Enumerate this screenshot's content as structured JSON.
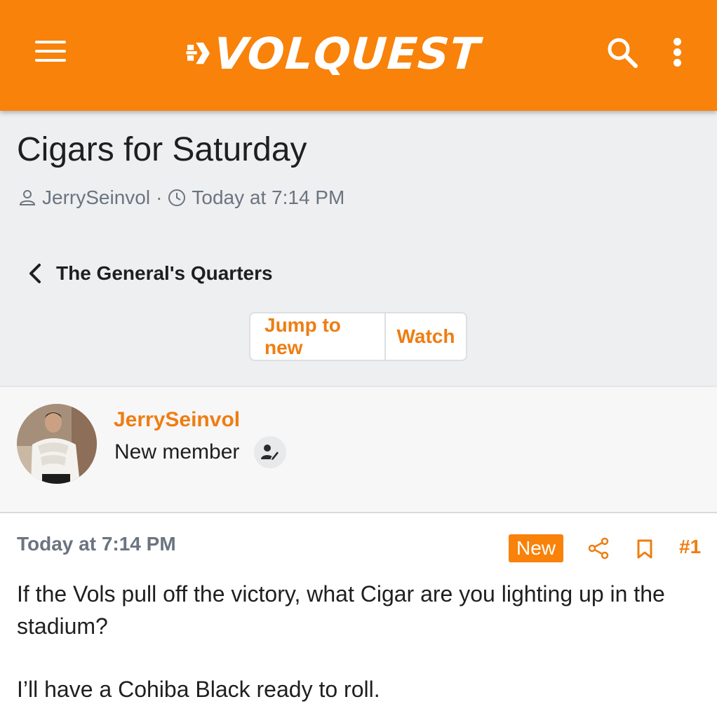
{
  "header": {
    "site_name": "VOLQUEST",
    "menu_icon": "hamburger-menu-icon",
    "search_icon": "search-icon",
    "more_icon": "more-vertical-icon",
    "brand_color": "#f8820a"
  },
  "thread": {
    "title": "Cigars for Saturday",
    "author": "JerrySeinvol",
    "separator": "·",
    "timestamp": "Today at 7:14 PM",
    "breadcrumb": "The General's Quarters",
    "buttons": {
      "jump_to_new": "Jump to new",
      "watch": "Watch"
    }
  },
  "post_author": {
    "name": "JerrySeinvol",
    "role": "New member"
  },
  "post": {
    "timestamp": "Today at 7:14 PM",
    "badge": "New",
    "number": "#1",
    "paragraphs": [
      "If the Vols pull off the victory, what Cigar are you lighting up in the stadium?",
      "I’ll have a Cohiba Black ready to roll."
    ]
  }
}
